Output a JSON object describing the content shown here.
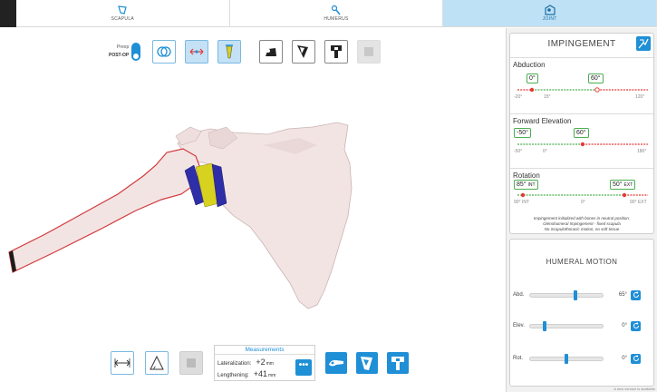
{
  "tabs": [
    {
      "label": "SCAPULA",
      "icon": "scapula-icon"
    },
    {
      "label": "HUMERUS",
      "icon": "humerus-icon"
    },
    {
      "label": "JOINT",
      "icon": "joint-icon"
    }
  ],
  "active_tab": "JOINT",
  "toolbar": {
    "toggle_top": "Preop",
    "toggle_bottom": "POST-OP"
  },
  "impingement": {
    "title": "IMPINGEMENT",
    "abduction": {
      "label": "Abduction",
      "left_value": "0°",
      "right_value": "60°",
      "ticks": [
        "-20°",
        "15°",
        "120°"
      ]
    },
    "forward_elevation": {
      "label": "Forward Elevation",
      "left_value": "-50°",
      "right_value": "60°",
      "ticks": [
        "-50°",
        "0°",
        "180°"
      ]
    },
    "rotation": {
      "label": "Rotation",
      "left_value": "85°",
      "left_unit": "INT",
      "right_value": "50°",
      "right_unit": "EXT",
      "ticks": [
        "90° INT",
        "0°",
        "90° EXT"
      ]
    },
    "note_lines": [
      "Impingement initialized with bones in neutral position.",
      "Glenohumeral Impingement - fixed scapula",
      "No Scapulothoracic motion, no soft tissue"
    ]
  },
  "humeral_motion": {
    "title": "HUMERAL MOTION",
    "rows": [
      {
        "label": "Abd.",
        "value": "65°",
        "level": 0.62
      },
      {
        "label": "Elev.",
        "value": "0°",
        "level": 0.2
      },
      {
        "label": "Rot.",
        "value": "0°",
        "level": 0.5
      }
    ]
  },
  "measurements": {
    "title": "Measurements",
    "lateralization_label": "Lateralization:",
    "lateralization_value": "+2",
    "lengthening_label": "Lengthening:",
    "lengthening_value": "+41",
    "unit": "mm",
    "more": "•••"
  },
  "footer_note": "A new version is available",
  "colors": {
    "accent": "#1f8fd6",
    "active_tab": "#bfe1f5",
    "bone": "#f3e4e4",
    "implant_blue": "#2e2ea8",
    "implant_yellow": "#d7d21f",
    "free_range": "#4caf50",
    "impinged_range": "#e53935"
  }
}
